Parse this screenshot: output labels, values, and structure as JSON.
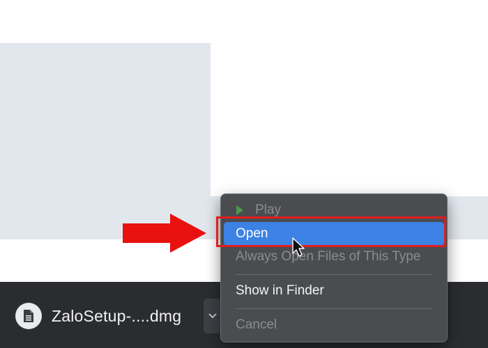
{
  "download_bar": {
    "file_name": "ZaloSetup-....dmg",
    "file_icon": "document-icon",
    "menu_button_icon": "chevron-down-icon"
  },
  "context_menu": {
    "items": [
      {
        "label": "Play",
        "icon": "play-icon",
        "state": "disabled"
      },
      {
        "label": "Open",
        "state": "highlighted"
      },
      {
        "label": "Always Open Files of This Type",
        "state": "disabled"
      },
      {
        "label": "Show in Finder",
        "state": "enabled"
      },
      {
        "label": "Cancel",
        "state": "disabled"
      }
    ]
  },
  "annotations": {
    "arrow_icon": "arrow-right-icon",
    "highlight_color": "#e01e1e"
  },
  "colors": {
    "menu_highlight": "#3c82e4",
    "download_bar_bg": "#2a2c30",
    "menu_bg": "#4a4c50",
    "play_icon": "#4f9a4a"
  }
}
